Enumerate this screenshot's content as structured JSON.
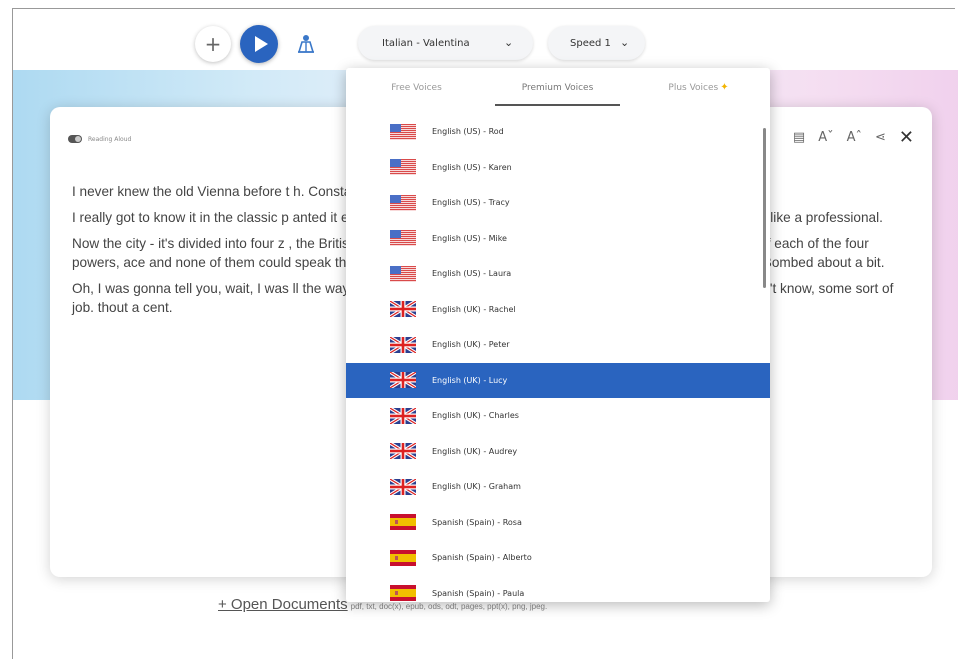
{
  "toolbar": {
    "add_label": "+",
    "voice_select": "Italian - Valentina",
    "speed_select": "Speed 1"
  },
  "dropdown": {
    "tabs": [
      {
        "label": "Free Voices"
      },
      {
        "label": "Premium Voices"
      },
      {
        "label": "Plus Voices"
      }
    ],
    "voices": [
      {
        "label": "English (US) - Rod",
        "flag": "us"
      },
      {
        "label": "English (US) - Karen",
        "flag": "us"
      },
      {
        "label": "English (US) - Tracy",
        "flag": "us"
      },
      {
        "label": "English (US) - Mike",
        "flag": "us"
      },
      {
        "label": "English (US) - Laura",
        "flag": "us"
      },
      {
        "label": "English (UK) - Rachel",
        "flag": "uk"
      },
      {
        "label": "English (UK) - Peter",
        "flag": "uk"
      },
      {
        "label": "English (UK) - Lucy",
        "flag": "uk",
        "selected": true
      },
      {
        "label": "English (UK) - Charles",
        "flag": "uk"
      },
      {
        "label": "English (UK) - Audrey",
        "flag": "uk"
      },
      {
        "label": "English (UK) - Graham",
        "flag": "uk"
      },
      {
        "label": "Spanish (Spain) - Rosa",
        "flag": "es"
      },
      {
        "label": "Spanish (Spain) - Alberto",
        "flag": "es"
      },
      {
        "label": "Spanish (Spain) - Paula",
        "flag": "es"
      }
    ]
  },
  "reader": {
    "reading_toggle_label": "Reading Aloud",
    "paragraphs": [
      "I never knew the old Vienna before t                                                                                        h. Constantinople suited me better.",
      "I really got to know it in the classic p                                                                                        anted it enough, and had the money to pay. Of cours                                                                                        they can't stay the course like a professional.",
      "Now the city - it's divided into four z                                                                                        , the British, the Russian and the French. But the cen                                                                                        nal Patrol. One member of each of the four powers,                                                                                        ace and none of them could speak the same languag                                                                                        n the whole, did their best you know. Vienna doesn't                                                                                        Bombed about a bit.",
      "Oh, I was gonna tell you, wait, I was                                                                                        ll the way here to visit a friend of his. The name is Lim                                                                                        red him, some sort, I don't know, some sort of job.                                                                                        thout a cent."
    ]
  },
  "footer": {
    "open_documents": "+ Open Documents",
    "formats": "pdf, txt, doc(x), epub, ods, odt, pages, ppt(x), png, jpeg."
  },
  "colors": {
    "accent": "#2a64bf",
    "star": "#f2b400"
  }
}
